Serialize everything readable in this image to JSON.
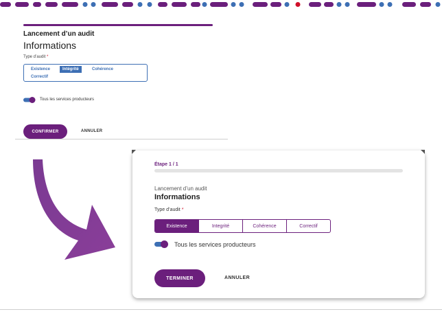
{
  "before": {
    "title": "Lancement d’un audit",
    "heading": "Informations",
    "type_label": "Type d’audit",
    "required_mark": "*",
    "options": [
      "Existence",
      "Intégrité",
      "Cohérence",
      "Correctif"
    ],
    "selected_option": "Intégrité",
    "toggle_label": "Tous les services producteurs",
    "confirm_label": "CONFIRMER",
    "cancel_label": "ANNULER"
  },
  "after": {
    "step": "Étape 1 / 1",
    "subtitle": "Lancement d’un audit",
    "heading": "Informations",
    "type_label": "Type d’audit",
    "required_mark": "*",
    "options": [
      "Existence",
      "Integrité",
      "Cohérence",
      "Correctif"
    ],
    "selected_option": "Existence",
    "toggle_label": "Tous les services producteurs",
    "finish_label": "TERMINER",
    "cancel_label": "ANNULER"
  },
  "colors": {
    "brand": "#6b1f7c",
    "before_accent": "#3d6fb4",
    "required": "#d0102a"
  }
}
